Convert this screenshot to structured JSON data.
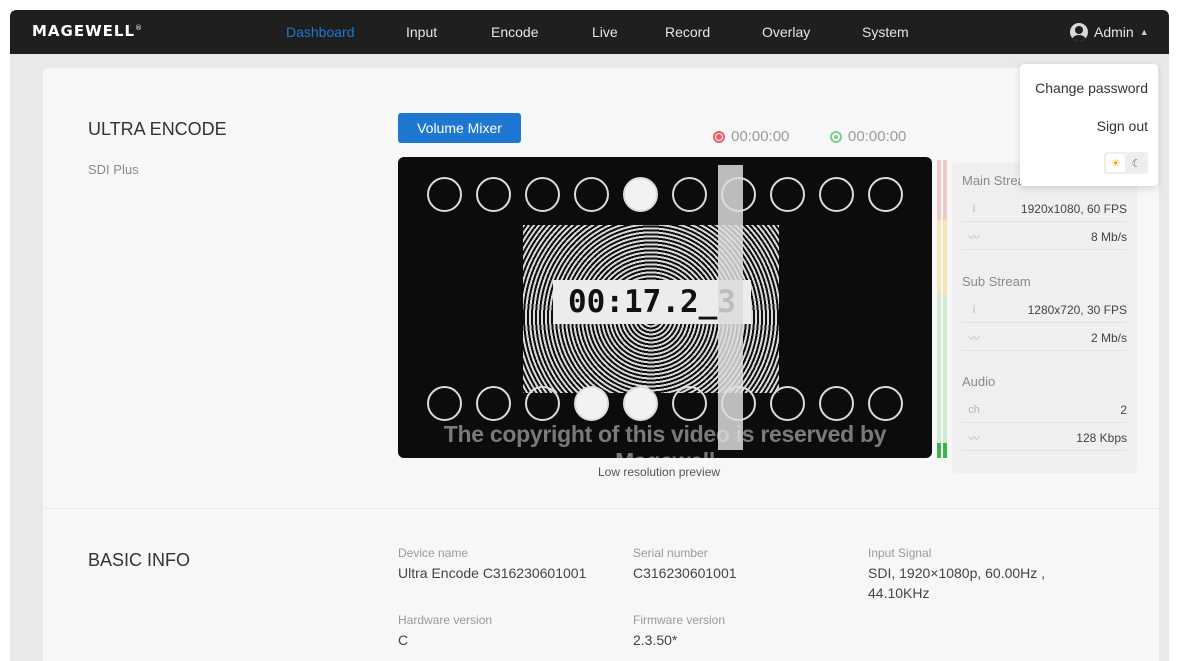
{
  "brand": {
    "logo_text": "MAGEWELL",
    "reg": "®"
  },
  "nav": {
    "items": [
      {
        "label": "Dashboard",
        "active": true
      },
      {
        "label": "Input",
        "active": false
      },
      {
        "label": "Encode",
        "active": false
      },
      {
        "label": "Live",
        "active": false
      },
      {
        "label": "Record",
        "active": false
      },
      {
        "label": "Overlay",
        "active": false
      },
      {
        "label": "System",
        "active": false
      }
    ],
    "user_label": "Admin",
    "accent_color": "#1e78d2"
  },
  "user_menu": {
    "change_password": "Change password",
    "sign_out": "Sign out",
    "theme_light_icon": "sun-icon",
    "theme_dark_icon": "moon-icon"
  },
  "device": {
    "title": "ULTRA ENCODE",
    "subtitle": "SDI Plus",
    "volume_mixer_label": "Volume Mixer",
    "record_timer": "00:00:00",
    "live_timer": "00:00:00"
  },
  "preview": {
    "timecode": "00:17.2_3",
    "copyright": "The copyright of this video is reserved by Magewell",
    "caption": "Low resolution preview",
    "top_circles_filled": [
      false,
      false,
      false,
      false,
      true,
      false,
      false,
      false,
      false,
      false
    ],
    "bottom_circles_filled": [
      false,
      false,
      false,
      true,
      true,
      false,
      false,
      false,
      false,
      false
    ],
    "audio_levels": [
      0.05,
      0.05
    ]
  },
  "streams": {
    "main": {
      "title": "Main Stream",
      "resolution": "1920x1080, 60 FPS",
      "bitrate": "8 Mb/s"
    },
    "sub": {
      "title": "Sub Stream",
      "resolution": "1280x720, 30 FPS",
      "bitrate": "2 Mb/s"
    },
    "audio": {
      "title": "Audio",
      "ch_label": "ch",
      "channels": "2",
      "bitrate": "128 Kbps"
    }
  },
  "basic_info": {
    "title": "BASIC INFO",
    "device_name_label": "Device name",
    "device_name": "Ultra Encode C316230601001",
    "serial_label": "Serial number",
    "serial": "C316230601001",
    "input_label": "Input Signal",
    "input_line1": "SDI, 1920×1080p, 60.00Hz ,",
    "input_line2": "44.10KHz",
    "hw_label": "Hardware version",
    "hw": "C",
    "fw_label": "Firmware version",
    "fw": "2.3.50*"
  }
}
